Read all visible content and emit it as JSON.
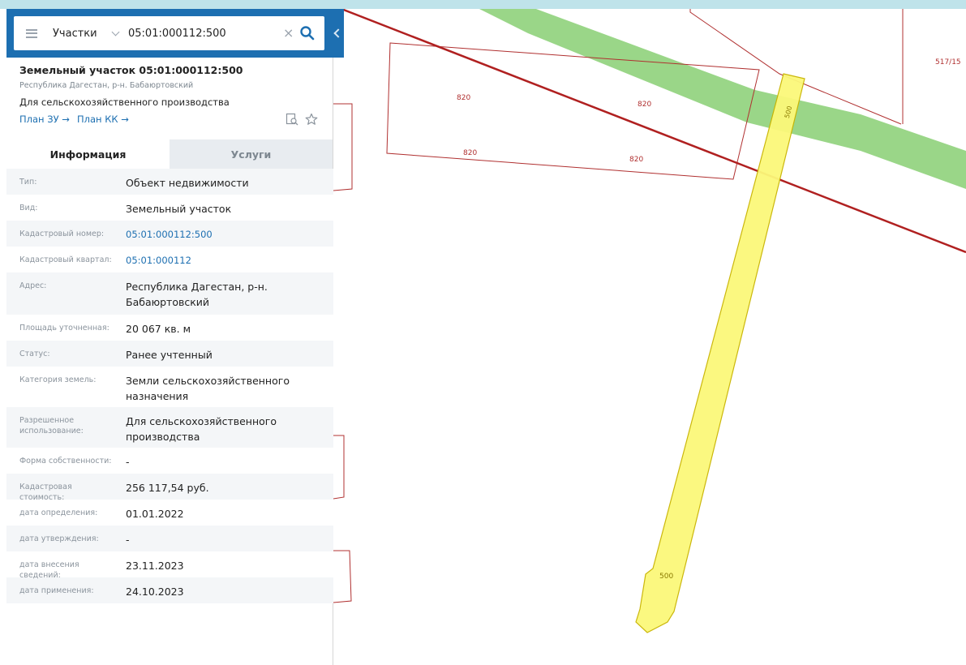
{
  "search": {
    "type": "Участки",
    "value": "05:01:000112:500"
  },
  "object": {
    "title": "Земельный участок 05:01:000112:500",
    "region": "Республика Дагестан, р-н. Бабаюртовский",
    "purpose": "Для сельскохозяйственного производства",
    "plan_zu": "План ЗУ →",
    "plan_kk": "План КК →"
  },
  "tabs": {
    "info": "Информация",
    "services": "Услуги"
  },
  "rows": [
    {
      "label": "Тип:",
      "value": "Объект недвижимости"
    },
    {
      "label": "Вид:",
      "value": "Земельный участок"
    },
    {
      "label": "Кадастровый номер:",
      "value": "05:01:000112:500"
    },
    {
      "label": "Кадастровый квартал:",
      "value": "05:01:000112"
    },
    {
      "label": "Адрес:",
      "value": "Республика Дагестан, р-н. Бабаюртовский"
    },
    {
      "label": "Площадь уточненная:",
      "value": "20 067 кв. м"
    },
    {
      "label": "Статус:",
      "value": "Ранее учтенный"
    },
    {
      "label": "Категория земель:",
      "value": "Земли сельскохозяйственного назначения"
    },
    {
      "label": "Разрешенное использование:",
      "value": "Для сельскохозяйственного производства"
    },
    {
      "label": "Форма собственности:",
      "value": "-"
    },
    {
      "label": "Кадастровая стоимость:",
      "value": "256 117,54 руб."
    },
    {
      "label": "дата определения:",
      "value": "01.01.2022"
    },
    {
      "label": "дата утверждения:",
      "value": "-"
    },
    {
      "label": "дата внесения сведений:",
      "value": "23.11.2023"
    },
    {
      "label": "дата применения:",
      "value": "24.10.2023"
    }
  ],
  "map": {
    "parcel_labels": [
      "820",
      "820",
      "820",
      "820",
      "500",
      "500",
      "517/15"
    ],
    "colors": {
      "parcel_border": "#b03030",
      "road_green": "#8fd17b",
      "selected_fill": "#fbf87a",
      "selected_border": "#c9b400"
    }
  }
}
